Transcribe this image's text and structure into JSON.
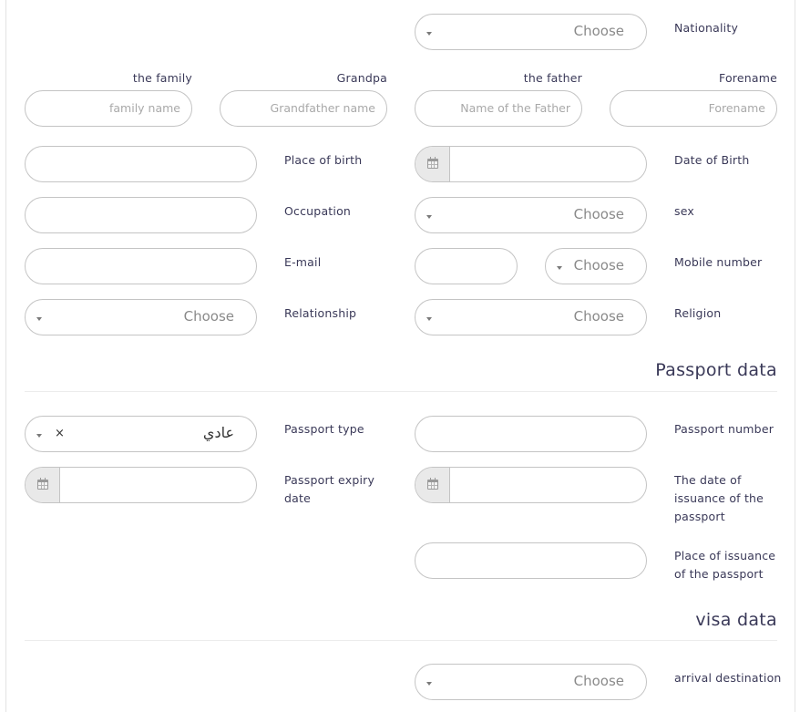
{
  "personal": {
    "nationality": {
      "label": "Nationality",
      "value": "Choose"
    },
    "family": {
      "label": "the family",
      "placeholder": "family name"
    },
    "grandpa": {
      "label": "Grandpa",
      "placeholder": "Grandfather name"
    },
    "father": {
      "label": "the father",
      "placeholder": "Name of the Father"
    },
    "forename": {
      "label": "Forename",
      "placeholder": "Forename"
    },
    "place_of_birth": {
      "label": "Place of birth",
      "value": ""
    },
    "date_of_birth": {
      "label": "Date of Birth",
      "value": "",
      "icon": "calendar-icon"
    },
    "occupation": {
      "label": "Occupation",
      "value": ""
    },
    "sex": {
      "label": "sex",
      "value": "Choose"
    },
    "email": {
      "label": "E-mail",
      "value": ""
    },
    "mobile": {
      "label": "Mobile number",
      "number_value": "",
      "code_value": "Choose"
    },
    "relationship": {
      "label": "Relationship",
      "value": "Choose"
    },
    "religion": {
      "label": "Religion",
      "value": "Choose"
    }
  },
  "passport": {
    "title": "Passport data",
    "type": {
      "label": "Passport type",
      "value": "عادي",
      "clear": "×"
    },
    "number": {
      "label": "Passport number",
      "value": ""
    },
    "expiry": {
      "label_line1": "Passport expiry",
      "label_line2": "date",
      "value": "",
      "icon": "calendar-icon"
    },
    "issue_date": {
      "label_line1": "The date of",
      "label_line2": "issuance of the",
      "label_line3": "passport",
      "value": "",
      "icon": "calendar-icon"
    },
    "issue_place": {
      "label_line1": "Place of issuance",
      "label_line2": "of the passport",
      "value": ""
    }
  },
  "visa": {
    "title": "visa data",
    "arrival_destination": {
      "label": "arrival destination",
      "value": "Choose"
    }
  }
}
